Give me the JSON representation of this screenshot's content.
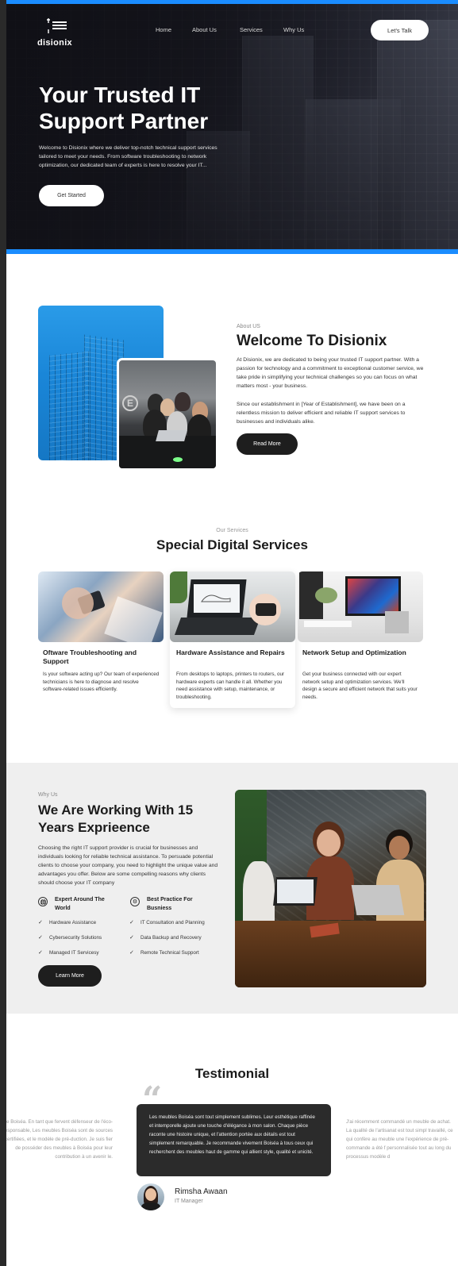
{
  "brand": {
    "name": "disionix",
    "accent": "#1a8cff"
  },
  "nav": {
    "items": [
      "Home",
      "About Us",
      "Services",
      "Why Us"
    ],
    "cta": "Let's Talk"
  },
  "hero": {
    "title": "Your Trusted IT Support Partner",
    "text": "Welcome to Disionix where we deliver top-notch technical support services tailored to meet your needs. From software troubleshooting to network optimization, our dedicated team of experts is here to resolve your IT...",
    "button": "Get Started"
  },
  "about": {
    "kicker": "About US",
    "title": "Welcome To Disionix",
    "p1": "At Disionix, we are dedicated to being your trusted IT support partner. With a passion for technology and a commitment to exceptional customer service, we take pride in simplifying your technical challenges so you can focus on what matters most - your business.",
    "p2": "Since our establishment in [Year of Establishment], we have been on a relentless mission to deliver efficient and reliable IT support services to businesses and individuals alike.",
    "button": "Read More"
  },
  "services": {
    "kicker": "Our Services",
    "title": "Special Digital Services",
    "items": [
      {
        "name": "Oftware Troubleshooting and Support",
        "desc": "Is your software acting up? Our team of experienced technicians is here to diagnose and resolve software-related issues efficiently."
      },
      {
        "name": "Hardware Assistance and Repairs",
        "desc": "From desktops to laptops, printers to routers, our hardware experts can handle it all. Whether you need assistance with setup, maintenance, or troubleshooting."
      },
      {
        "name": "Network Setup and Optimization",
        "desc": "Get your business connected with our expert network setup and optimization services. We'll design a secure and efficient network that suits your needs."
      }
    ]
  },
  "why": {
    "kicker": "Why Us",
    "title": "We Are Working With 15 Years Exprieence",
    "text": "Choosing the right IT support provider is crucial for businesses and individuals looking for reliable technical assistance. To persuade potential clients to choose your company, you need to highlight the unique value and advantages you offer. Below are some compelling reasons why clients should choose your IT company",
    "features": [
      {
        "icon": "globe-icon",
        "label": "Expert Around The World"
      },
      {
        "icon": "gear-icon",
        "label": "Best Practice For Busniess"
      }
    ],
    "checks_left": [
      "Hardware Assistance",
      "Cybersecurity Solutions",
      "Managed IT Servicesy"
    ],
    "checks_right": [
      "IT Consultation and Planning",
      "Data Backup and Recovery",
      "Remote Technical Support"
    ],
    "button": "Learn More"
  },
  "testimonial": {
    "title": "Testimonial",
    "quote": "Les meubles Boiséa sont tout simplement sublimes. Leur esthétique raffinée et intemporelle ajoute une touche d'élégance à mon salon. Chaque pièce raconte une histoire unique, et l'attention portée aux détails est tout simplement remarquable. Je recommande vivement Boiséa à tous ceux qui recherchent des meubles haut de gamme qui allient style, qualité et unicité.",
    "author": "Rimsha Awaan",
    "role": "IT Manager",
    "side_left": "de Boiséa. En tant que fervent défenseur de l'éco-responsable, Les meubles Boiséa sont de sources certifiées, et le modèle de pré-duction. Je suis fier de posséder des meubles à Boiséa pour leur contribution à un avenir le.",
    "side_right": "J'ai récemment commandé un meuble de achat. La qualité de l'artisanat est tout simpl travaillé, ce qui confère au meuble une l'expérience de pré-commande a été f personnalisée tout au long du processus modèle d"
  }
}
